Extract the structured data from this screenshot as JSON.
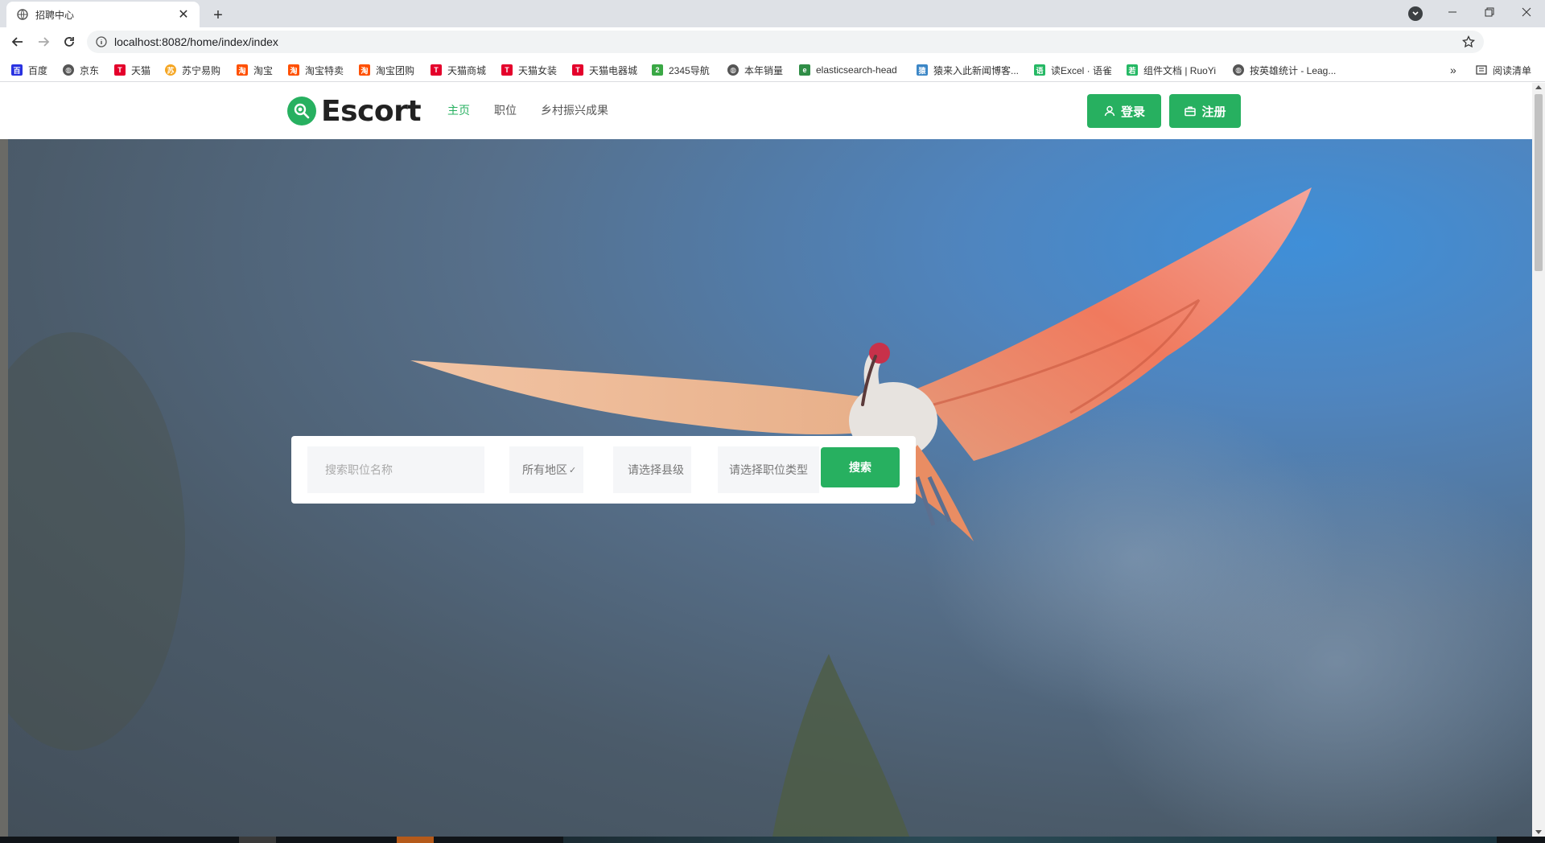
{
  "browser": {
    "tab_title": "招聘中心",
    "url": "localhost:8082/home/index/index",
    "bookmarks": [
      {
        "label": "百度",
        "icon": "baidu-icon",
        "color": "#2932e1"
      },
      {
        "label": "京东",
        "icon": "globe-icon",
        "color": "#555555"
      },
      {
        "label": "天猫",
        "icon": "tmall-icon",
        "color": "#e4002b"
      },
      {
        "label": "苏宁易购",
        "icon": "suning-icon",
        "color": "#f5a623"
      },
      {
        "label": "淘宝",
        "icon": "taobao-icon",
        "color": "#ff5000"
      },
      {
        "label": "淘宝特卖",
        "icon": "taobao-icon",
        "color": "#ff5000"
      },
      {
        "label": "淘宝团购",
        "icon": "taobao-icon",
        "color": "#ff5000"
      },
      {
        "label": "天猫商城",
        "icon": "tmall-icon",
        "color": "#e4002b"
      },
      {
        "label": "天猫女装",
        "icon": "tmall-icon",
        "color": "#e4002b"
      },
      {
        "label": "天猫电器城",
        "icon": "tmall-icon",
        "color": "#e4002b"
      },
      {
        "label": "2345导航",
        "icon": "nav2345-icon",
        "color": "#3aa845"
      },
      {
        "label": "本年销量",
        "icon": "globe-icon",
        "color": "#555555"
      },
      {
        "label": "elasticsearch-head",
        "icon": "elastic-icon",
        "color": "#2f8d46"
      },
      {
        "label": "猿来入此新闻博客...",
        "icon": "blog-icon",
        "color": "#3b86c6"
      },
      {
        "label": "读Excel · 语雀",
        "icon": "yuque-icon",
        "color": "#25b864"
      },
      {
        "label": "组件文档 | RuoYi",
        "icon": "ruoyi-icon",
        "color": "#25b864"
      },
      {
        "label": "按英雄统计 - Leag...",
        "icon": "globe-icon",
        "color": "#555555"
      }
    ],
    "reading_list": "阅读清单",
    "overflow": "»"
  },
  "site": {
    "logo_text": "Escort",
    "nav": [
      {
        "label": "主页",
        "active": true
      },
      {
        "label": "职位",
        "active": false
      },
      {
        "label": "乡村振兴成果",
        "active": false
      }
    ],
    "login_label": "登录",
    "register_label": "注册",
    "accent_color": "#27b060"
  },
  "search": {
    "job_placeholder": "搜索职位名称",
    "region_label": "所有地区",
    "county_label": "请选择县级",
    "type_label": "请选择职位类型",
    "submit_label": "搜索"
  }
}
